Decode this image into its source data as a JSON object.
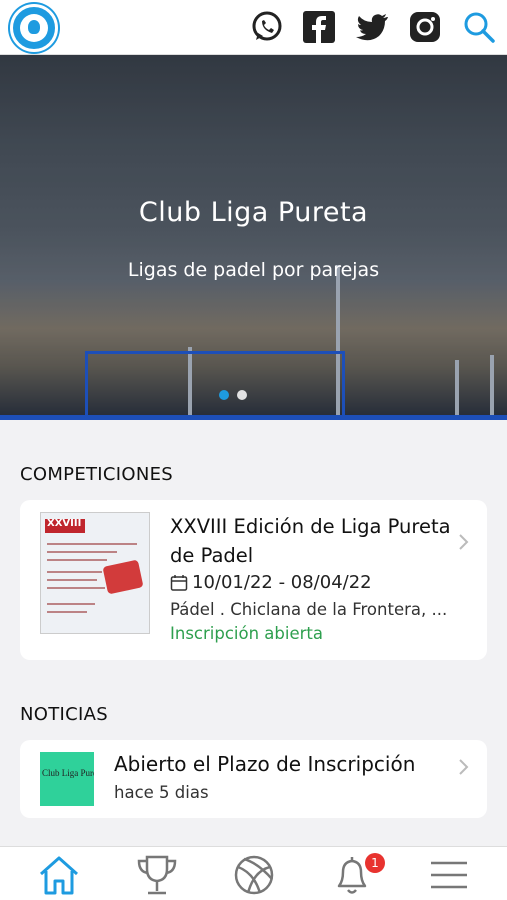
{
  "header": {
    "icons": [
      "logo-icon",
      "whatsapp-icon",
      "facebook-icon",
      "twitter-icon",
      "instagram-icon",
      "search-icon"
    ]
  },
  "hero": {
    "title": "Club Liga Pureta",
    "subtitle": "Ligas de padel por parejas",
    "carousel": {
      "count": 2,
      "active_index": 0
    }
  },
  "competitions": {
    "section_title": "COMPETICIONES",
    "items": [
      {
        "title": "XXVIII Edición de Liga Pureta de Padel",
        "dates": "10/01/22 - 08/04/22",
        "place": "Pádel . Chiclana de la Frontera, ...",
        "status": "Inscripción abierta",
        "thumb_text": "XXVIII"
      }
    ]
  },
  "news": {
    "section_title": "NOTICIAS",
    "items": [
      {
        "title": "Abierto el Plazo de Inscripción",
        "time": "hace 5 dias",
        "thumb_text": "Club Liga Pureta"
      }
    ]
  },
  "tabbar": {
    "items": [
      "home-icon",
      "trophy-icon",
      "ball-icon",
      "bell-icon",
      "menu-icon"
    ],
    "notification_count": "1"
  },
  "colors": {
    "accent": "#1e9be0",
    "status_open": "#2e9f4e",
    "badge": "#e8332f"
  }
}
